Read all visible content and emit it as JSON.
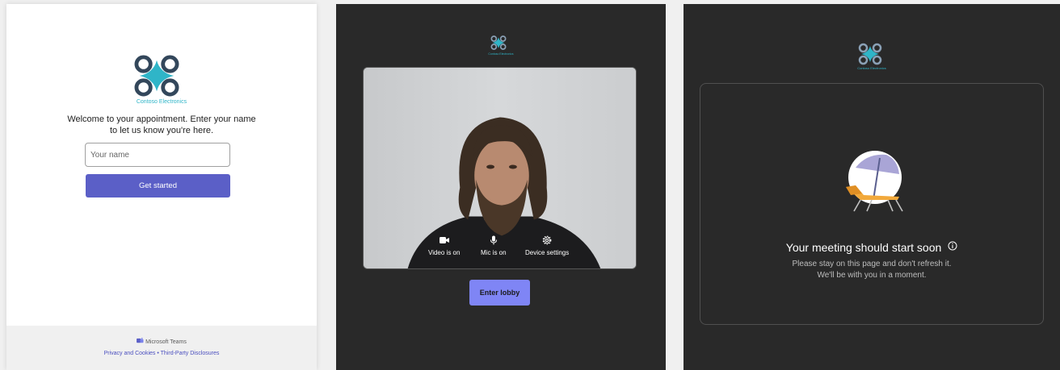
{
  "checkin": {
    "brand": "Contoso Electronics",
    "welcome": "Welcome to your appointment. Enter your name to let us know you're here.",
    "name_placeholder": "Your name",
    "get_started_label": "Get started",
    "footer_app": "Microsoft Teams",
    "privacy_link": "Privacy and Cookies",
    "separator": "•",
    "disclosures_link": "Third-Party Disclosures"
  },
  "prejoin": {
    "brand": "Contoso Electronics",
    "controls": [
      {
        "icon": "video-camera-icon",
        "label": "Video is on"
      },
      {
        "icon": "microphone-icon",
        "label": "Mic is on"
      },
      {
        "icon": "gear-icon",
        "label": "Device settings"
      }
    ],
    "enter_lobby_label": "Enter lobby"
  },
  "lobby": {
    "brand": "Contoso Electronics",
    "title": "Your meeting should start soon",
    "line1": "Please stay on this page and don't refresh it.",
    "line2": "We'll be with you in a moment."
  },
  "colors": {
    "accent": "#5b5fc7",
    "accent_light": "#7f85f5",
    "brand_teal": "#2fb5c8",
    "dark_bg": "#292929"
  }
}
